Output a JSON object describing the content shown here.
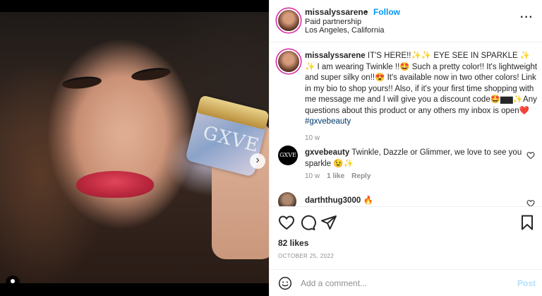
{
  "header": {
    "username": "missalyssarene",
    "separator": "•",
    "follow_label": "Follow",
    "partnership": "Paid partnership",
    "location": "Los Angeles, California",
    "more_label": "···"
  },
  "caption": {
    "username": "missalyssarene",
    "text_1": " IT'S HERE!!✨✨ EYE SEE IN SPARKLE ✨ ✨ I am wearing Twinkle !!🤩 Such a pretty color!! It's lightweight and super silky on!!😍 It's available now in two other colors! Link in my bio to shop yours!! Also, if it's your first time shopping with me message me and I will give you a discount code🤩▆▆✨Any questions about this product or any others my inbox is open❤️",
    "hashtag": "#gxvebeauty",
    "time": "10 w"
  },
  "comments": [
    {
      "username": "gxvebeauty",
      "avatar_text": "GXVE",
      "text": " Twinkle, Dazzle or Glimmer, we love to see you sparkle 😉✨",
      "time": "10 w",
      "likes": "1 like",
      "reply": "Reply"
    },
    {
      "username": "darththug3000",
      "text": " 🔥"
    }
  ],
  "media": {
    "jar_text": "GXVE",
    "next_icon": "›"
  },
  "actions": {
    "likes": "82 likes",
    "date": "OCTOBER 25, 2022"
  },
  "add_comment": {
    "placeholder": "Add a comment...",
    "post_label": "Post"
  },
  "colors": {
    "link_blue": "#0095f6",
    "post_disabled": "#b2dffc",
    "hashtag": "#00376b",
    "muted": "#8e8e8e"
  },
  "icons": [
    "heart-icon",
    "comment-icon",
    "share-icon",
    "bookmark-icon",
    "emoji-icon",
    "tag-user-icon",
    "next-arrow-icon"
  ]
}
